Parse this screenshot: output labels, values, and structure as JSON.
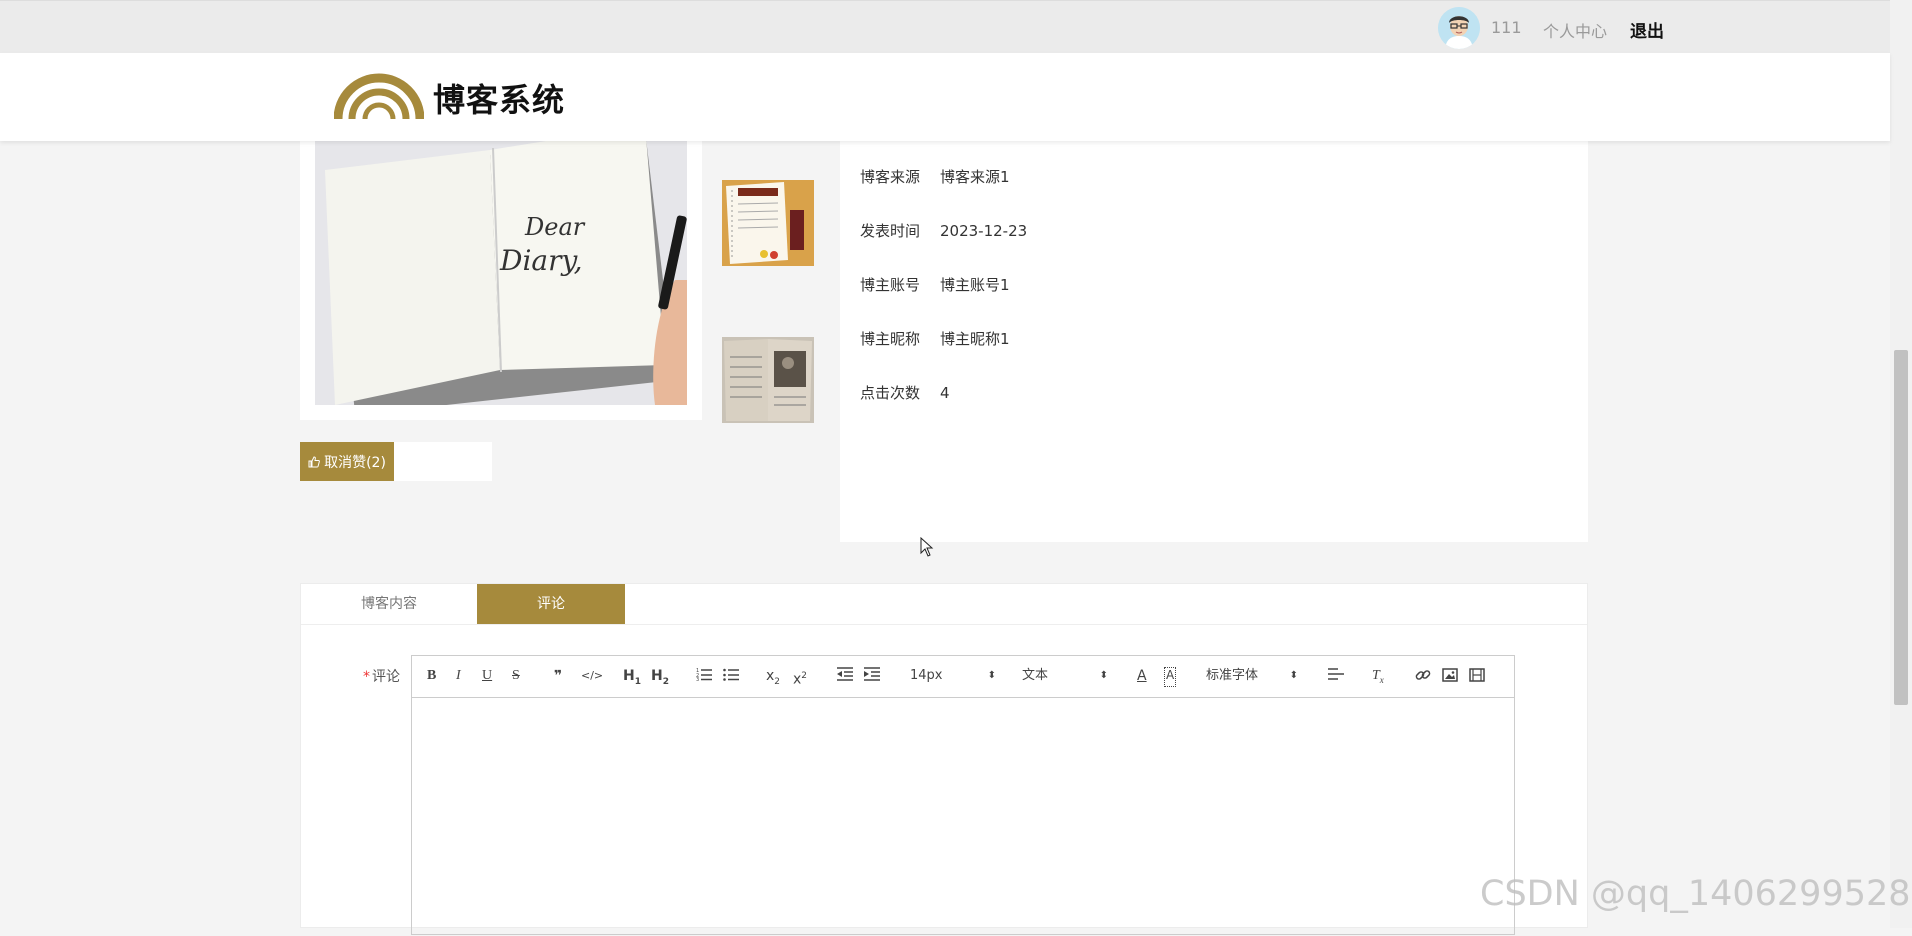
{
  "topbar": {
    "username": "111",
    "personal_center": "个人中心",
    "logout": "退出"
  },
  "header": {
    "site_title": "博客系统"
  },
  "gallery": {
    "main_image_text_1": "Dear",
    "main_image_text_2": "Diary,"
  },
  "like": {
    "label": "取消赞(2)"
  },
  "info": {
    "rows": [
      {
        "label": "博客来源",
        "value": "博客来源1"
      },
      {
        "label": "发表时间",
        "value": "2023-12-23"
      },
      {
        "label": "博主账号",
        "value": "博主账号1"
      },
      {
        "label": "博主昵称",
        "value": "博主昵称1"
      },
      {
        "label": "点击次数",
        "value": "4"
      }
    ]
  },
  "tabs": [
    {
      "label": "博客内容",
      "active": false
    },
    {
      "label": "评论",
      "active": true
    }
  ],
  "comment": {
    "required_mark": "*",
    "label": "评论",
    "toolbar": {
      "font_size": "14px",
      "header_type": "文本",
      "font_family": "标准字体"
    }
  },
  "watermark": "CSDN @qq_1406299528",
  "colors": {
    "accent": "#a68a3c",
    "background": "#f4f4f4"
  }
}
